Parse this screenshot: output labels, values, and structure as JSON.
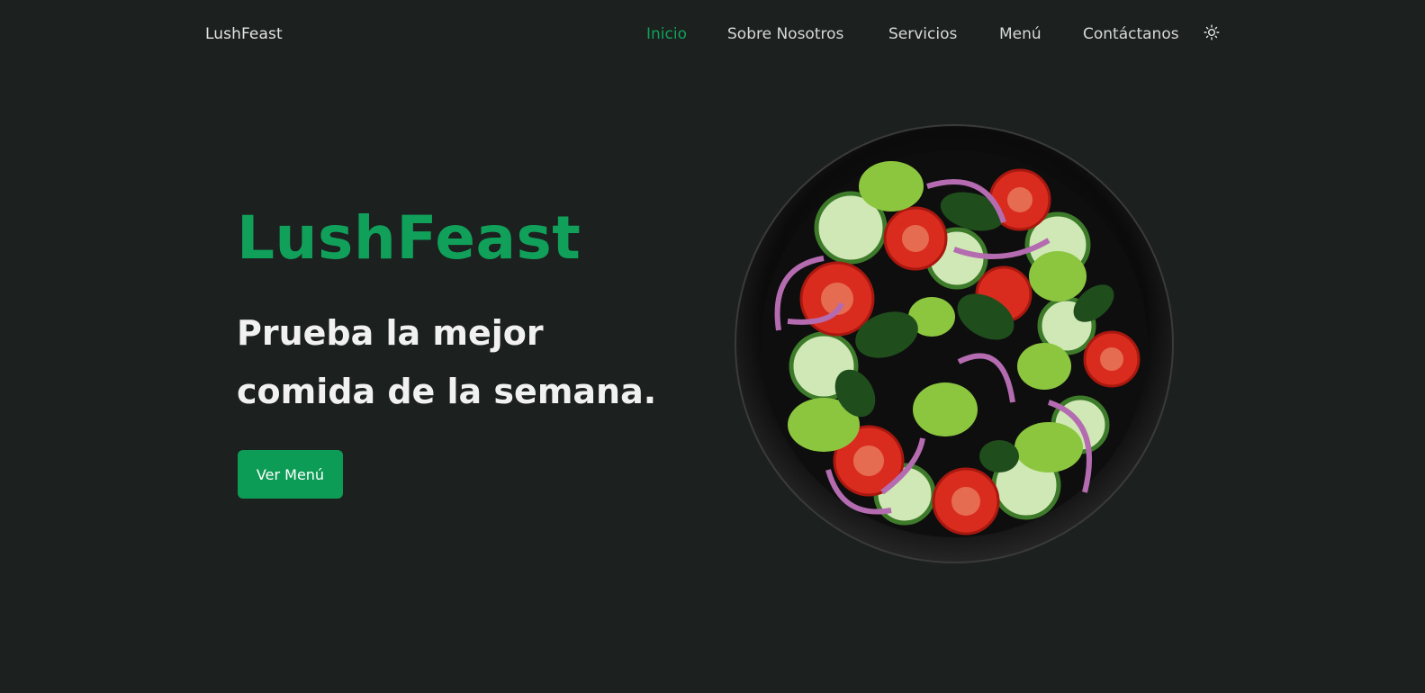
{
  "header": {
    "brand": "LushFeast",
    "nav": {
      "inicio": "Inicio",
      "sobre": "Sobre Nosotros",
      "servicios": "Servicios",
      "menu": "Menú",
      "contacto": "Contáctanos"
    },
    "theme_icon": "sun-icon"
  },
  "hero": {
    "title": "LushFeast",
    "subtitle": "Prueba la mejor comida de la semana.",
    "cta_label": "Ver Menú",
    "image_icon": "salad-bowl-image"
  },
  "colors": {
    "background": "#1c201f",
    "accent": "#10a05a",
    "button": "#0d9c56",
    "text": "#f1f1f1",
    "nav_text": "#d8d8d8"
  }
}
